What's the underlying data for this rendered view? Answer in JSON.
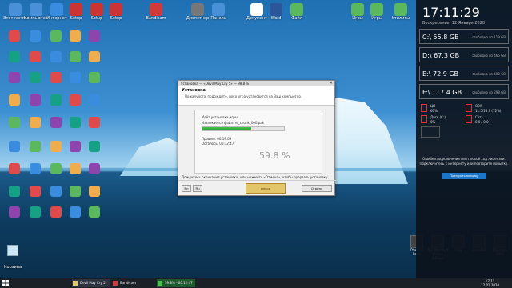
{
  "desktop": {
    "icons": [
      {
        "label": "Этот компьютер",
        "color": "#4a90d9"
      },
      {
        "label": "Компьютер",
        "color": "#4a90d9"
      },
      {
        "label": "Интернет",
        "color": "#3a8dde"
      },
      {
        "label": "Setup",
        "color": "#cc3333"
      },
      {
        "label": "Setup",
        "color": "#cc3333"
      },
      {
        "label": "Setup",
        "color": "#cc3333"
      },
      {
        "label": "Bandicam",
        "color": "#d23a3a"
      },
      {
        "label": "Диспетчер",
        "color": "#777777"
      },
      {
        "label": "Панель",
        "color": "#4a90d9"
      },
      {
        "label": "Документ",
        "color": "#ffffff"
      },
      {
        "label": "Word",
        "color": "#2b579a"
      },
      {
        "label": "Файл",
        "color": "#5cb85c"
      },
      {
        "label": "Игры",
        "color": "#5cb85c"
      },
      {
        "label": "Игры",
        "color": "#5cb85c"
      },
      {
        "label": "Утилиты",
        "color": "#5cb85c"
      }
    ],
    "recycle_bin_label": "Корзина",
    "bottom_right_icons": [
      {
        "label": "Phoenix Point"
      },
      {
        "label": "Two Worlds II Velvet Edition"
      },
      {
        "label": "Prey"
      },
      {
        "label": "GreedFall"
      },
      {
        "label": "Daymare 1998"
      }
    ]
  },
  "panel": {
    "time": "17:11:29",
    "date": "Воскресенье, 12 Января 2020",
    "drives": [
      {
        "letter": "C:\\",
        "used": "55.8 GB",
        "free_text": "свободно из 119 GB"
      },
      {
        "letter": "D:\\",
        "used": "67.3 GB",
        "free_text": "свободно из 465 GB"
      },
      {
        "letter": "E:\\",
        "used": "72.9 GB",
        "free_text": "свободно из 400 GB"
      },
      {
        "letter": "F:\\",
        "used": "117.4 GB",
        "free_text": "свободно из 298 GB"
      }
    ],
    "monitor": {
      "cpu_label": "ЦП",
      "cpu_value": "60%",
      "ram_label": "ОЗУ",
      "ram_value": "11.5/15.9 (72%)",
      "disk_label": "Диск (C:)",
      "disk_value": "0%",
      "net_label": "Сеть",
      "net_value": "0.0 / 0.0"
    },
    "error_text": "Ошибка подключения или плохой ход лицензии. Подключитесь к интернету или повторите попытку.",
    "retry_label": "Повторить попытку"
  },
  "dialog": {
    "title": "Установка — «Devil May Cry 5» — 98.8 %",
    "header_title": "Установка",
    "header_sub": "Пожалуйста, подождите, пока игра установится на Ваш компьютер.",
    "step": "Идёт установка игры...",
    "file": "Извлекается файл: re_chunk_000.pak",
    "elapsed": "Прошло: 00:19:09",
    "remaining": "Осталось: 00:12:47",
    "percent": "59.8 %",
    "progress": 0.598,
    "footer": "Дождитесь окончания установки, или нажмите «Отмена», чтобы прервать установку.",
    "btn_left1": "En",
    "btn_left2": "Ru",
    "btn_cancel": "Отмена",
    "logo_text": "REPACK"
  },
  "taskbar": {
    "items": [
      {
        "label": "Devil May Cry 5 (R..."
      },
      {
        "label": "Bandicam"
      },
      {
        "label": "59.8% - 00:12:47"
      }
    ],
    "clock_time": "17:11",
    "clock_date": "12.01.2020"
  }
}
